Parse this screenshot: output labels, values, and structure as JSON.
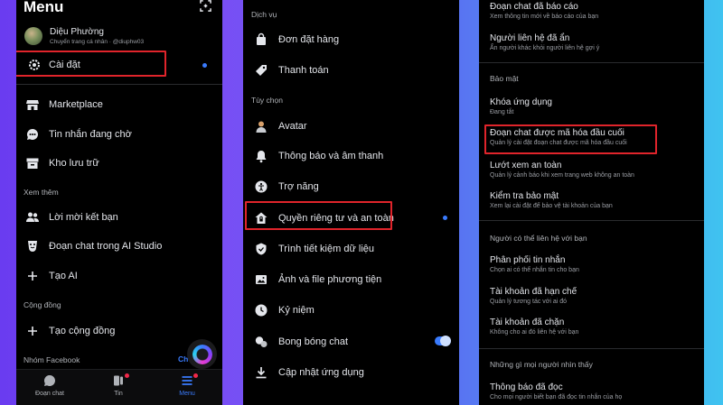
{
  "menu": {
    "title": "Menu",
    "profile": {
      "name": "Diệu Phường",
      "subtitle": "Chuyển trang cá nhân · @diuphw03"
    },
    "settings_label": "Cài đặt",
    "items": [
      {
        "icon": "shop-icon",
        "label": "Marketplace"
      },
      {
        "icon": "chat-waiting-icon",
        "label": "Tin nhắn đang chờ"
      },
      {
        "icon": "archive-icon",
        "label": "Kho lưu trữ"
      }
    ],
    "see_more_header": "Xem thêm",
    "see_more_items": [
      {
        "icon": "people-icon",
        "label": "Lời mời kết bạn"
      },
      {
        "icon": "ai-studio-icon",
        "label": "Đoạn chat trong AI Studio"
      },
      {
        "icon": "plus-icon",
        "label": "Tạo AI"
      }
    ],
    "community_header": "Cộng đồng",
    "community_items": [
      {
        "icon": "plus-icon",
        "label": "Tạo cộng đồng"
      }
    ],
    "facebook_groups_header": "Nhóm Facebook",
    "facebook_groups_action": "Ch",
    "tabs": [
      {
        "icon": "chat-bubble-icon",
        "label": "Đoạn chat"
      },
      {
        "icon": "stories-icon",
        "label": "Tin"
      },
      {
        "icon": "menu-icon",
        "label": "Menu"
      }
    ]
  },
  "settings": {
    "services_header": "Dịch vụ",
    "services": [
      {
        "icon": "bag-icon",
        "label": "Đơn đặt hàng"
      },
      {
        "icon": "payment-tag-icon",
        "label": "Thanh toán"
      }
    ],
    "options_header": "Tùy chọn",
    "options": [
      {
        "icon": "avatar-icon",
        "label": "Avatar"
      },
      {
        "icon": "bell-icon",
        "label": "Thông báo và âm thanh"
      },
      {
        "icon": "accessibility-icon",
        "label": "Trợ năng"
      },
      {
        "icon": "privacy-home-icon",
        "label": "Quyền riêng tư và an toàn"
      },
      {
        "icon": "data-saver-icon",
        "label": "Trình tiết kiệm dữ liệu"
      },
      {
        "icon": "photo-icon",
        "label": "Ảnh và file phương tiện"
      },
      {
        "icon": "memories-icon",
        "label": "Kỷ niệm"
      },
      {
        "icon": "chat-bubbles-icon",
        "label": "Bong bóng chat"
      },
      {
        "icon": "download-icon",
        "label": "Cập nhật ứng dụng"
      }
    ]
  },
  "privacy": {
    "top_items": [
      {
        "label": "Đoạn chat đã báo cáo",
        "sub": "Xem thông tin mới về báo cáo của bạn"
      },
      {
        "label": "Người liên hệ đã ẩn",
        "sub": "Ẩn người khác khỏi người liên hệ gợi ý"
      }
    ],
    "security_header": "Bảo mật",
    "security_items": [
      {
        "label": "Khóa ứng dụng",
        "sub": "Đang tắt"
      },
      {
        "label": "Đoạn chat được mã hóa đầu cuối",
        "sub": "Quản lý cài đặt đoạn chat được mã hóa đầu cuối"
      },
      {
        "label": "Lướt xem an toàn",
        "sub": "Quản lý cảnh báo khi xem trang web không an toàn"
      },
      {
        "label": "Kiểm tra bảo mật",
        "sub": "Xem lại cài đặt để bảo vệ tài khoản của bạn"
      }
    ],
    "contact_header": "Người có thể liên hệ với bạn",
    "contact_items": [
      {
        "label": "Phân phối tin nhắn",
        "sub": "Chọn ai có thể nhắn tin cho bạn"
      },
      {
        "label": "Tài khoản đã hạn chế",
        "sub": "Quản lý tương tác với ai đó"
      },
      {
        "label": "Tài khoản đã chặn",
        "sub": "Không cho ai đó liên hệ với bạn"
      }
    ],
    "seen_header": "Những gì mọi người nhìn thấy",
    "seen_items": [
      {
        "label": "Thông báo đã đọc",
        "sub": "Cho mọi người biết bạn đã đọc tin nhắn của họ"
      }
    ]
  },
  "colors": {
    "highlight": "#e0242b",
    "accent": "#3a7bfd",
    "panel_bg": "#000000"
  }
}
